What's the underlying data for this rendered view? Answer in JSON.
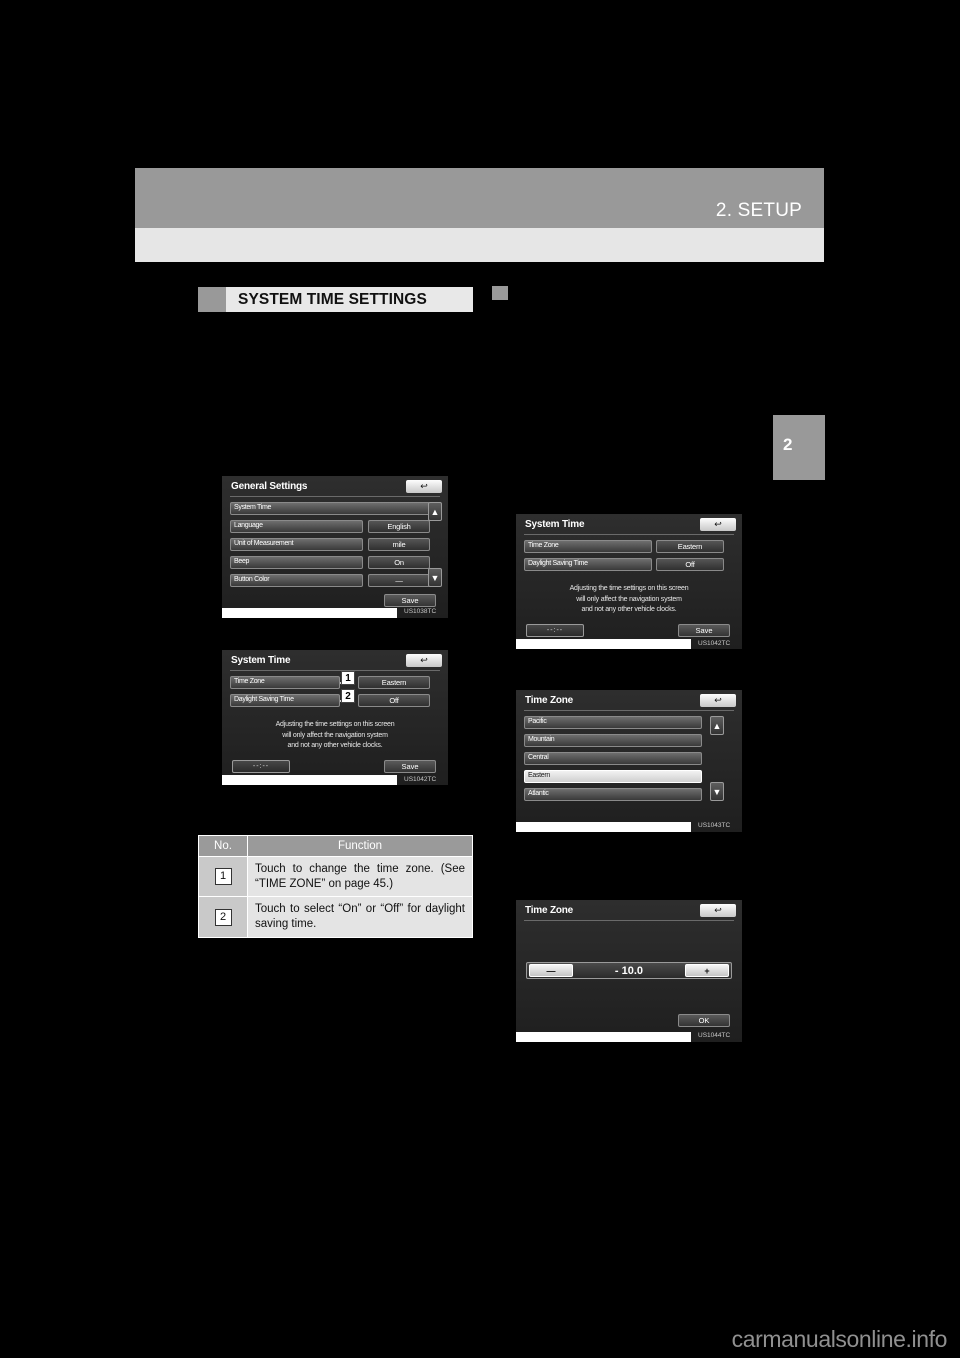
{
  "page": {
    "chapter_number": "2",
    "header_title": "2. SETUP",
    "section_title": "SYSTEM TIME SETTINGS",
    "watermark": "carmanualsonline.info"
  },
  "screens": {
    "general_settings": {
      "title": "General Settings",
      "back_icon": "back-arrow-icon",
      "rows": [
        {
          "label": "System Time",
          "value": ""
        },
        {
          "label": "Language",
          "value": "English"
        },
        {
          "label": "Unit of Measurement",
          "value": "mile"
        },
        {
          "label": "Beep",
          "value": "On"
        },
        {
          "label": "Button Color",
          "value": "—"
        }
      ],
      "save_label": "Save",
      "scroll_up_icon": "scroll-up-icon",
      "scroll_down_icon": "scroll-down-icon",
      "caption": "US1038TC"
    },
    "system_time_callouts": {
      "title": "System Time",
      "back_icon": "back-arrow-icon",
      "rows": [
        {
          "label": "Time Zone",
          "value": "Eastern",
          "callout": "1"
        },
        {
          "label": "Daylight Saving Time",
          "value": "Off",
          "callout": "2"
        }
      ],
      "note": "Adjusting the time settings on this screen will only affect the navigation system and not any other vehicle clocks.",
      "note_lines": [
        "Adjusting the time settings on this screen",
        "will only affect the navigation system",
        "and not any other vehicle clocks."
      ],
      "clock": "--:--",
      "save_label": "Save",
      "caption": "US1042TC"
    },
    "system_time_plain": {
      "title": "System Time",
      "back_icon": "back-arrow-icon",
      "rows": [
        {
          "label": "Time Zone",
          "value": "Eastern"
        },
        {
          "label": "Daylight Saving Time",
          "value": "Off"
        }
      ],
      "note_lines": [
        "Adjusting the time settings on this screen",
        "will only affect the navigation system",
        "and not any other vehicle clocks."
      ],
      "clock": "--:--",
      "save_label": "Save",
      "caption": "US1042TC"
    },
    "time_zone_list": {
      "title": "Time Zone",
      "back_icon": "back-arrow-icon",
      "items": [
        {
          "label": "Pacific",
          "selected": false
        },
        {
          "label": "Mountain",
          "selected": false
        },
        {
          "label": "Central",
          "selected": false
        },
        {
          "label": "Eastern",
          "selected": true
        },
        {
          "label": "Atlantic",
          "selected": false
        }
      ],
      "scroll_up_icon": "scroll-up-icon",
      "scroll_down_icon": "scroll-down-icon",
      "caption": "US1043TC"
    },
    "time_zone_adjust": {
      "title": "Time Zone",
      "back_icon": "back-arrow-icon",
      "minus_label": "—",
      "plus_label": "+",
      "value": "- 10.0",
      "ok_label": "OK",
      "caption": "US1044TC"
    }
  },
  "function_table": {
    "headers": [
      "No.",
      "Function"
    ],
    "rows": [
      {
        "no": "1",
        "function": "Touch to change the time zone. (See “TIME ZONE” on page 45.)"
      },
      {
        "no": "2",
        "function": "Touch to select “On” or “Off” for daylight saving time."
      }
    ]
  }
}
